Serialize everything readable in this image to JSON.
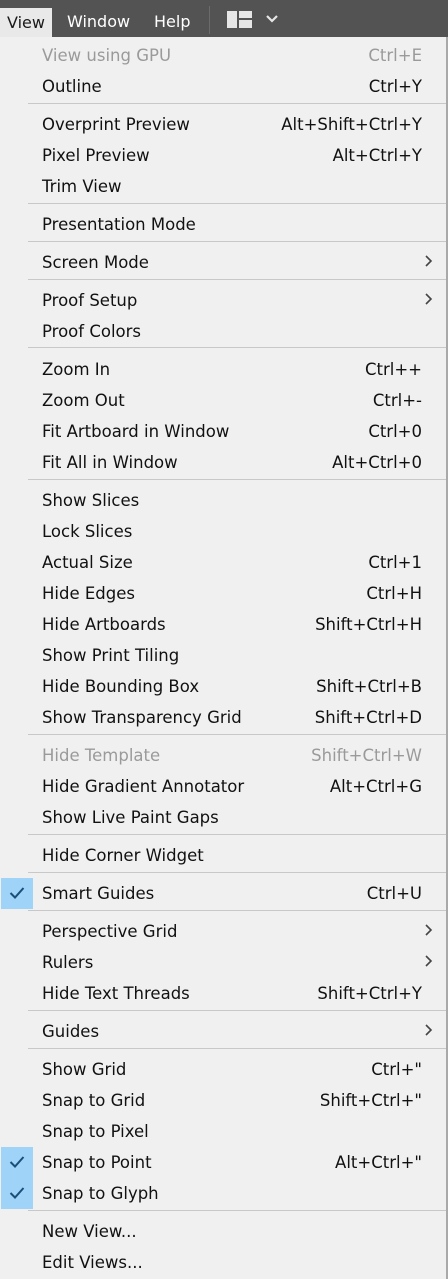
{
  "menubar": {
    "items": [
      "View",
      "Window",
      "Help"
    ],
    "active": "View",
    "workspace_icon": "workspace-layout-icon",
    "colors": {
      "bar": "#535353",
      "active_bg": "#e9e9e9"
    }
  },
  "menu": {
    "colors": {
      "background": "#f0f0f0",
      "checked_bg": "#9fd3f7",
      "disabled_text": "#9a9a9a"
    },
    "items": [
      {
        "label": "View using GPU",
        "shortcut": "Ctrl+E",
        "disabled": true
      },
      {
        "label": "Outline",
        "shortcut": "Ctrl+Y"
      },
      {
        "label": "Overprint Preview",
        "shortcut": "Alt+Shift+Ctrl+Y"
      },
      {
        "label": "Pixel Preview",
        "shortcut": "Alt+Ctrl+Y"
      },
      {
        "label": "Trim View",
        "shortcut": ""
      },
      {
        "label": "Presentation Mode",
        "shortcut": ""
      },
      {
        "label": "Screen Mode",
        "shortcut": "",
        "submenu": true
      },
      {
        "label": "Proof Setup",
        "shortcut": "",
        "submenu": true
      },
      {
        "label": "Proof Colors",
        "shortcut": ""
      },
      {
        "label": "Zoom In",
        "shortcut": "Ctrl++"
      },
      {
        "label": "Zoom Out",
        "shortcut": "Ctrl+-"
      },
      {
        "label": "Fit Artboard in Window",
        "shortcut": "Ctrl+0"
      },
      {
        "label": "Fit All in Window",
        "shortcut": "Alt+Ctrl+0"
      },
      {
        "label": "Show Slices",
        "shortcut": ""
      },
      {
        "label": "Lock Slices",
        "shortcut": ""
      },
      {
        "label": "Actual Size",
        "shortcut": "Ctrl+1"
      },
      {
        "label": "Hide Edges",
        "shortcut": "Ctrl+H"
      },
      {
        "label": "Hide Artboards",
        "shortcut": "Shift+Ctrl+H"
      },
      {
        "label": "Show Print Tiling",
        "shortcut": ""
      },
      {
        "label": "Hide Bounding Box",
        "shortcut": "Shift+Ctrl+B"
      },
      {
        "label": "Show Transparency Grid",
        "shortcut": "Shift+Ctrl+D"
      },
      {
        "label": "Hide Template",
        "shortcut": "Shift+Ctrl+W",
        "disabled": true
      },
      {
        "label": "Hide Gradient Annotator",
        "shortcut": "Alt+Ctrl+G"
      },
      {
        "label": "Show Live Paint Gaps",
        "shortcut": ""
      },
      {
        "label": "Hide Corner Widget",
        "shortcut": ""
      },
      {
        "label": "Smart Guides",
        "shortcut": "Ctrl+U",
        "checked": true
      },
      {
        "label": "Perspective Grid",
        "shortcut": "",
        "submenu": true
      },
      {
        "label": "Rulers",
        "shortcut": "",
        "submenu": true
      },
      {
        "label": "Hide Text Threads",
        "shortcut": "Shift+Ctrl+Y"
      },
      {
        "label": "Guides",
        "shortcut": "",
        "submenu": true
      },
      {
        "label": "Show Grid",
        "shortcut": "Ctrl+\""
      },
      {
        "label": "Snap to Grid",
        "shortcut": "Shift+Ctrl+\""
      },
      {
        "label": "Snap to Pixel",
        "shortcut": ""
      },
      {
        "label": "Snap to Point",
        "shortcut": "Alt+Ctrl+\"",
        "checked": true
      },
      {
        "label": "Snap to Glyph",
        "shortcut": "",
        "checked": true
      },
      {
        "label": "New View...",
        "shortcut": ""
      },
      {
        "label": "Edit Views...",
        "shortcut": ""
      }
    ]
  }
}
